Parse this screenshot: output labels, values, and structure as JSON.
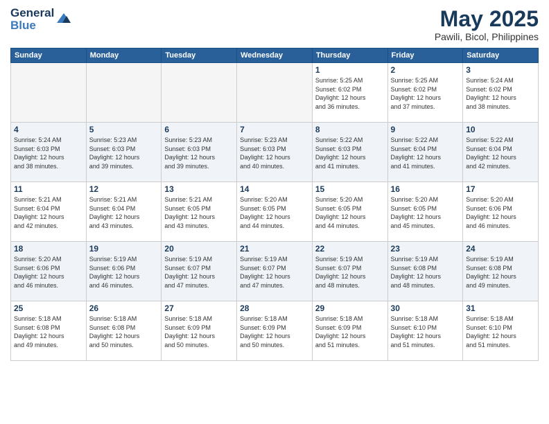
{
  "logo": {
    "line1": "General",
    "line2": "Blue"
  },
  "title": "May 2025",
  "subtitle": "Pawili, Bicol, Philippines",
  "days_of_week": [
    "Sunday",
    "Monday",
    "Tuesday",
    "Wednesday",
    "Thursday",
    "Friday",
    "Saturday"
  ],
  "weeks": [
    [
      {
        "day": "",
        "info": ""
      },
      {
        "day": "",
        "info": ""
      },
      {
        "day": "",
        "info": ""
      },
      {
        "day": "",
        "info": ""
      },
      {
        "day": "1",
        "info": "Sunrise: 5:25 AM\nSunset: 6:02 PM\nDaylight: 12 hours\nand 36 minutes."
      },
      {
        "day": "2",
        "info": "Sunrise: 5:25 AM\nSunset: 6:02 PM\nDaylight: 12 hours\nand 37 minutes."
      },
      {
        "day": "3",
        "info": "Sunrise: 5:24 AM\nSunset: 6:02 PM\nDaylight: 12 hours\nand 38 minutes."
      }
    ],
    [
      {
        "day": "4",
        "info": "Sunrise: 5:24 AM\nSunset: 6:03 PM\nDaylight: 12 hours\nand 38 minutes."
      },
      {
        "day": "5",
        "info": "Sunrise: 5:23 AM\nSunset: 6:03 PM\nDaylight: 12 hours\nand 39 minutes."
      },
      {
        "day": "6",
        "info": "Sunrise: 5:23 AM\nSunset: 6:03 PM\nDaylight: 12 hours\nand 39 minutes."
      },
      {
        "day": "7",
        "info": "Sunrise: 5:23 AM\nSunset: 6:03 PM\nDaylight: 12 hours\nand 40 minutes."
      },
      {
        "day": "8",
        "info": "Sunrise: 5:22 AM\nSunset: 6:03 PM\nDaylight: 12 hours\nand 41 minutes."
      },
      {
        "day": "9",
        "info": "Sunrise: 5:22 AM\nSunset: 6:04 PM\nDaylight: 12 hours\nand 41 minutes."
      },
      {
        "day": "10",
        "info": "Sunrise: 5:22 AM\nSunset: 6:04 PM\nDaylight: 12 hours\nand 42 minutes."
      }
    ],
    [
      {
        "day": "11",
        "info": "Sunrise: 5:21 AM\nSunset: 6:04 PM\nDaylight: 12 hours\nand 42 minutes."
      },
      {
        "day": "12",
        "info": "Sunrise: 5:21 AM\nSunset: 6:04 PM\nDaylight: 12 hours\nand 43 minutes."
      },
      {
        "day": "13",
        "info": "Sunrise: 5:21 AM\nSunset: 6:05 PM\nDaylight: 12 hours\nand 43 minutes."
      },
      {
        "day": "14",
        "info": "Sunrise: 5:20 AM\nSunset: 6:05 PM\nDaylight: 12 hours\nand 44 minutes."
      },
      {
        "day": "15",
        "info": "Sunrise: 5:20 AM\nSunset: 6:05 PM\nDaylight: 12 hours\nand 44 minutes."
      },
      {
        "day": "16",
        "info": "Sunrise: 5:20 AM\nSunset: 6:05 PM\nDaylight: 12 hours\nand 45 minutes."
      },
      {
        "day": "17",
        "info": "Sunrise: 5:20 AM\nSunset: 6:06 PM\nDaylight: 12 hours\nand 46 minutes."
      }
    ],
    [
      {
        "day": "18",
        "info": "Sunrise: 5:20 AM\nSunset: 6:06 PM\nDaylight: 12 hours\nand 46 minutes."
      },
      {
        "day": "19",
        "info": "Sunrise: 5:19 AM\nSunset: 6:06 PM\nDaylight: 12 hours\nand 46 minutes."
      },
      {
        "day": "20",
        "info": "Sunrise: 5:19 AM\nSunset: 6:07 PM\nDaylight: 12 hours\nand 47 minutes."
      },
      {
        "day": "21",
        "info": "Sunrise: 5:19 AM\nSunset: 6:07 PM\nDaylight: 12 hours\nand 47 minutes."
      },
      {
        "day": "22",
        "info": "Sunrise: 5:19 AM\nSunset: 6:07 PM\nDaylight: 12 hours\nand 48 minutes."
      },
      {
        "day": "23",
        "info": "Sunrise: 5:19 AM\nSunset: 6:08 PM\nDaylight: 12 hours\nand 48 minutes."
      },
      {
        "day": "24",
        "info": "Sunrise: 5:19 AM\nSunset: 6:08 PM\nDaylight: 12 hours\nand 49 minutes."
      }
    ],
    [
      {
        "day": "25",
        "info": "Sunrise: 5:18 AM\nSunset: 6:08 PM\nDaylight: 12 hours\nand 49 minutes."
      },
      {
        "day": "26",
        "info": "Sunrise: 5:18 AM\nSunset: 6:08 PM\nDaylight: 12 hours\nand 50 minutes."
      },
      {
        "day": "27",
        "info": "Sunrise: 5:18 AM\nSunset: 6:09 PM\nDaylight: 12 hours\nand 50 minutes."
      },
      {
        "day": "28",
        "info": "Sunrise: 5:18 AM\nSunset: 6:09 PM\nDaylight: 12 hours\nand 50 minutes."
      },
      {
        "day": "29",
        "info": "Sunrise: 5:18 AM\nSunset: 6:09 PM\nDaylight: 12 hours\nand 51 minutes."
      },
      {
        "day": "30",
        "info": "Sunrise: 5:18 AM\nSunset: 6:10 PM\nDaylight: 12 hours\nand 51 minutes."
      },
      {
        "day": "31",
        "info": "Sunrise: 5:18 AM\nSunset: 6:10 PM\nDaylight: 12 hours\nand 51 minutes."
      }
    ]
  ]
}
